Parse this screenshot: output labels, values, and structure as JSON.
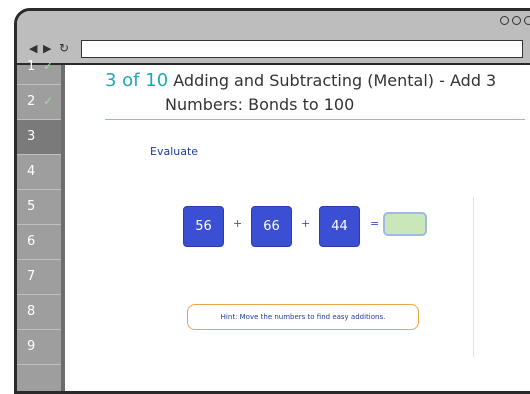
{
  "browser": {
    "nav": {
      "back": "◀",
      "forward": "▶",
      "reload": "↻",
      "menu": "⋮"
    },
    "address": {
      "value": ""
    }
  },
  "sidebar": {
    "items": [
      {
        "label": "1",
        "done": true,
        "active": false
      },
      {
        "label": "2",
        "done": true,
        "active": false
      },
      {
        "label": "3",
        "done": false,
        "active": true
      },
      {
        "label": "4",
        "done": false,
        "active": false
      },
      {
        "label": "5",
        "done": false,
        "active": false
      },
      {
        "label": "6",
        "done": false,
        "active": false
      },
      {
        "label": "7",
        "done": false,
        "active": false
      },
      {
        "label": "8",
        "done": false,
        "active": false
      },
      {
        "label": "9",
        "done": false,
        "active": false
      }
    ],
    "check_glyph": "✓"
  },
  "question": {
    "progress": "3 of 10",
    "title_line1": "Adding and Subtracting (Mental) - Add 3",
    "title_line2": "Numbers: Bonds to 100",
    "instruction": "Evaluate",
    "numbers": [
      "56",
      "66",
      "44"
    ],
    "ops": [
      "+",
      "+",
      "="
    ],
    "answer": "",
    "hint": "Hint: Move the numbers to find easy additions."
  },
  "colors": {
    "tile": "#3a4fd4",
    "progress": "#1fa7b8",
    "check": "#8fe39b",
    "answer_box": "#c9e7b8",
    "hint_border": "#f0a44a"
  }
}
